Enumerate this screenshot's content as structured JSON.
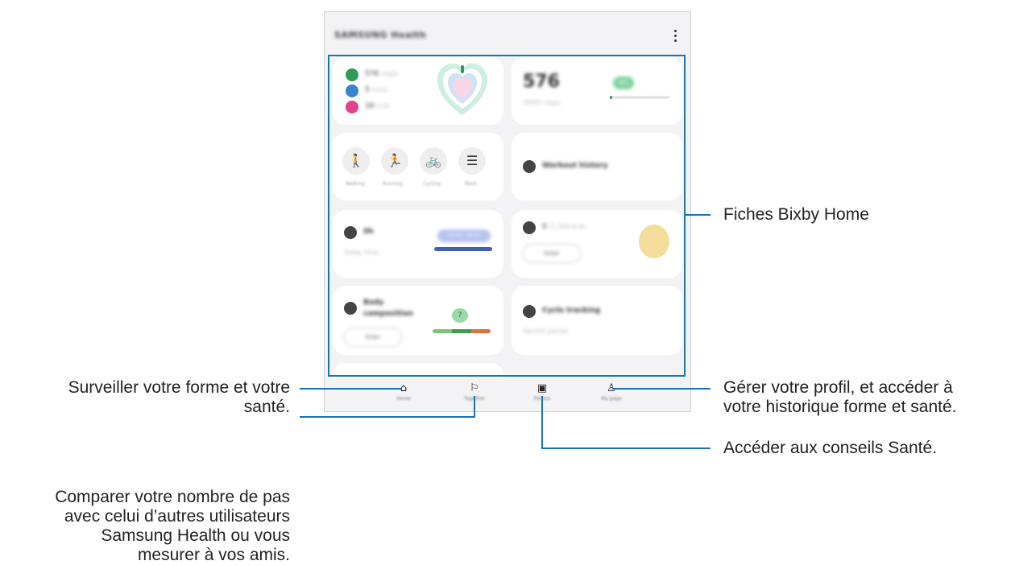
{
  "app": {
    "title": "SAMSUNG Health",
    "menu_icon": "kebab-menu-icon"
  },
  "cards": {
    "activity": {
      "rows": [
        {
          "icon": "steps-icon",
          "color": "#2e9b5a",
          "value": "576",
          "unit": "steps"
        },
        {
          "icon": "time-icon",
          "color": "#3c83d0",
          "value": "5",
          "unit": "mins"
        },
        {
          "icon": "calorie-icon",
          "color": "#e0448a",
          "value": "16",
          "unit": "kcal"
        }
      ]
    },
    "steps": {
      "value": "576",
      "sub": "/6000 steps",
      "badge": "8%"
    },
    "exercise": {
      "items": [
        {
          "icon": "walking-icon",
          "glyph": "🚶",
          "label": "Walking"
        },
        {
          "icon": "running-icon",
          "glyph": "🏃",
          "label": "Running"
        },
        {
          "icon": "cycling-icon",
          "glyph": "🚲",
          "label": "Cycling"
        },
        {
          "icon": "list-icon",
          "glyph": "☰",
          "label": "More"
        }
      ]
    },
    "workout_history": {
      "title": "Workout history"
    },
    "sleep": {
      "value": "0h",
      "sub": "Sleep time",
      "bubble": "22:00 - 06:00"
    },
    "food": {
      "value": "0",
      "unit": "/1,500 kcal",
      "button": "Enter"
    },
    "body": {
      "title": "Body composition",
      "button": "Enter",
      "badge": "?"
    },
    "cycle": {
      "title": "Cycle tracking",
      "sub": "Record period"
    }
  },
  "nav": {
    "items": [
      {
        "icon": "home-icon",
        "glyph": "⌂",
        "label": "Home"
      },
      {
        "icon": "flag-icon",
        "glyph": "⚐",
        "label": "Together"
      },
      {
        "icon": "fitness-icon",
        "glyph": "▣",
        "label": "Fitness"
      },
      {
        "icon": "person-icon",
        "glyph": "♙",
        "label": "My page"
      }
    ]
  },
  "callouts": {
    "cards": "Fiches Bixby Home",
    "profile_line1": "Gérer votre profil, et accéder à",
    "profile_line2": "votre historique forme et santé.",
    "home_line1": "Surveiller votre forme et votre",
    "home_line2": "santé.",
    "together_line1": "Comparer votre nombre de pas",
    "together_line2": "avec celui d’autres utilisateurs",
    "together_line3": "Samsung Health ou vous",
    "together_line4": "mesurer à vos amis.",
    "fitness": "Accéder aux conseils Santé."
  },
  "colors": {
    "callout_line": "#1a73b5",
    "phone_bg": "#f3f3f5",
    "card_bg": "#ffffff"
  }
}
